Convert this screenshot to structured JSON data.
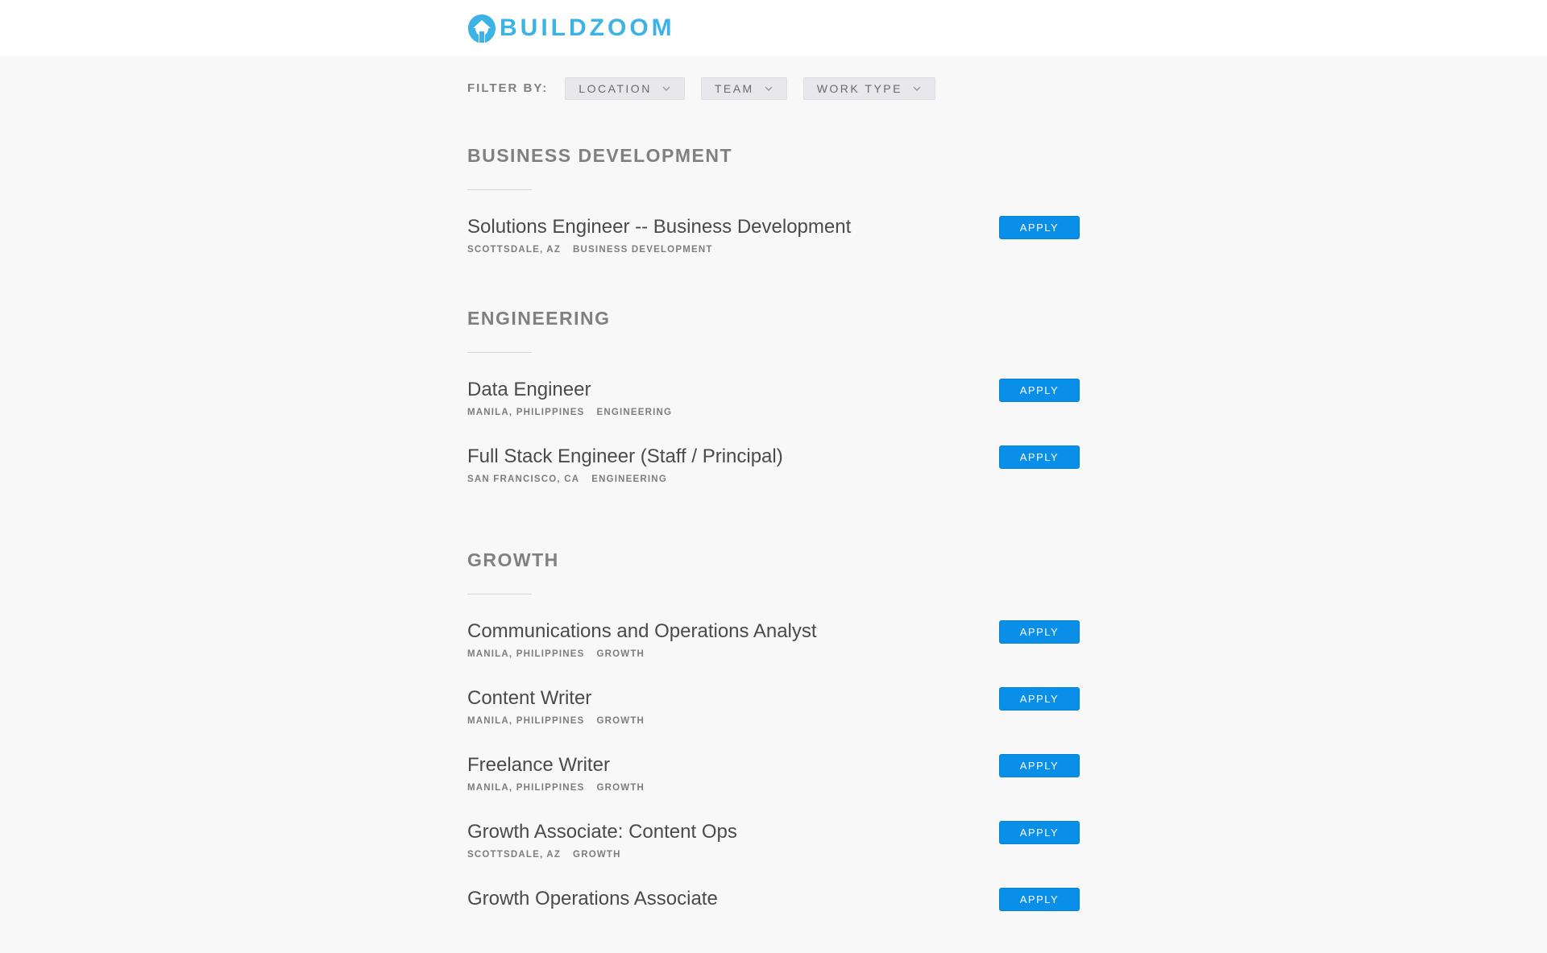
{
  "brand": {
    "name": "BUILDZOOM",
    "color": "#3bb3e6"
  },
  "filters": {
    "label": "FILTER BY:",
    "options": [
      "LOCATION",
      "TEAM",
      "WORK TYPE"
    ]
  },
  "apply_label": "APPLY",
  "sections": [
    {
      "title": "BUSINESS DEVELOPMENT",
      "postings": [
        {
          "title": "Solutions Engineer -- Business Development",
          "location": "SCOTTSDALE, AZ",
          "team": "BUSINESS DEVELOPMENT"
        }
      ]
    },
    {
      "title": "ENGINEERING",
      "postings": [
        {
          "title": "Data Engineer",
          "location": "MANILA, PHILIPPINES",
          "team": "ENGINEERING"
        },
        {
          "title": "Full Stack Engineer (Staff / Principal)",
          "location": "SAN FRANCISCO, CA",
          "team": "ENGINEERING"
        }
      ]
    },
    {
      "title": "GROWTH",
      "postings": [
        {
          "title": "Communications and Operations Analyst",
          "location": "MANILA, PHILIPPINES",
          "team": "GROWTH"
        },
        {
          "title": "Content Writer",
          "location": "MANILA, PHILIPPINES",
          "team": "GROWTH"
        },
        {
          "title": "Freelance Writer",
          "location": "MANILA, PHILIPPINES",
          "team": "GROWTH"
        },
        {
          "title": "Growth Associate: Content Ops",
          "location": "SCOTTSDALE, AZ",
          "team": "GROWTH"
        },
        {
          "title": "Growth Operations Associate",
          "location": "",
          "team": ""
        }
      ]
    }
  ],
  "colors": {
    "accent": "#0a8fe8",
    "background": "#f8f8f8"
  }
}
